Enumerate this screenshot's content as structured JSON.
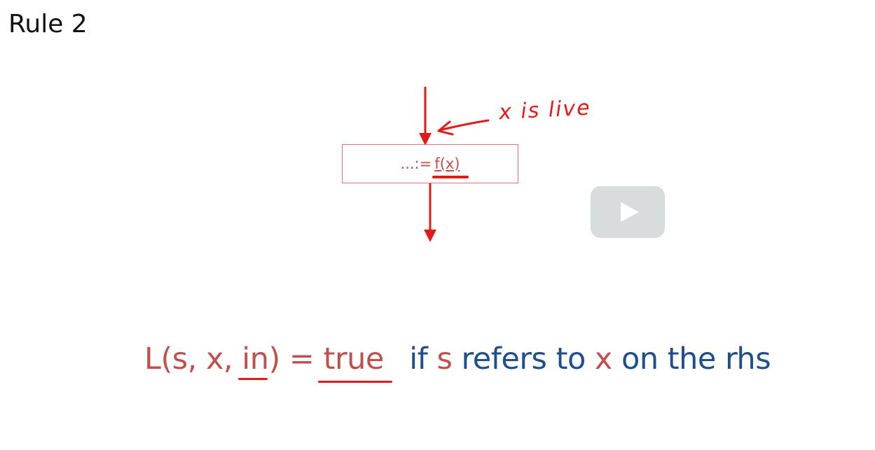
{
  "slide": {
    "title": "Rule 2"
  },
  "diagram": {
    "statement_prefix": "...:=",
    "statement_call": "f(x)",
    "annotation": "x is live"
  },
  "player": {
    "play_label": "Play"
  },
  "rule": {
    "lhs": "L(s, x, in)",
    "equals": "=",
    "value": "true",
    "if_word": "if",
    "s_var": "s",
    "refers_to": "refers to",
    "x_var": "x",
    "on_the_rhs": "on the rhs"
  },
  "colors": {
    "ink_red": "#e21a1a",
    "text_red": "#c0504d",
    "text_blue": "#1f4e8c",
    "box_border": "#e57373"
  }
}
